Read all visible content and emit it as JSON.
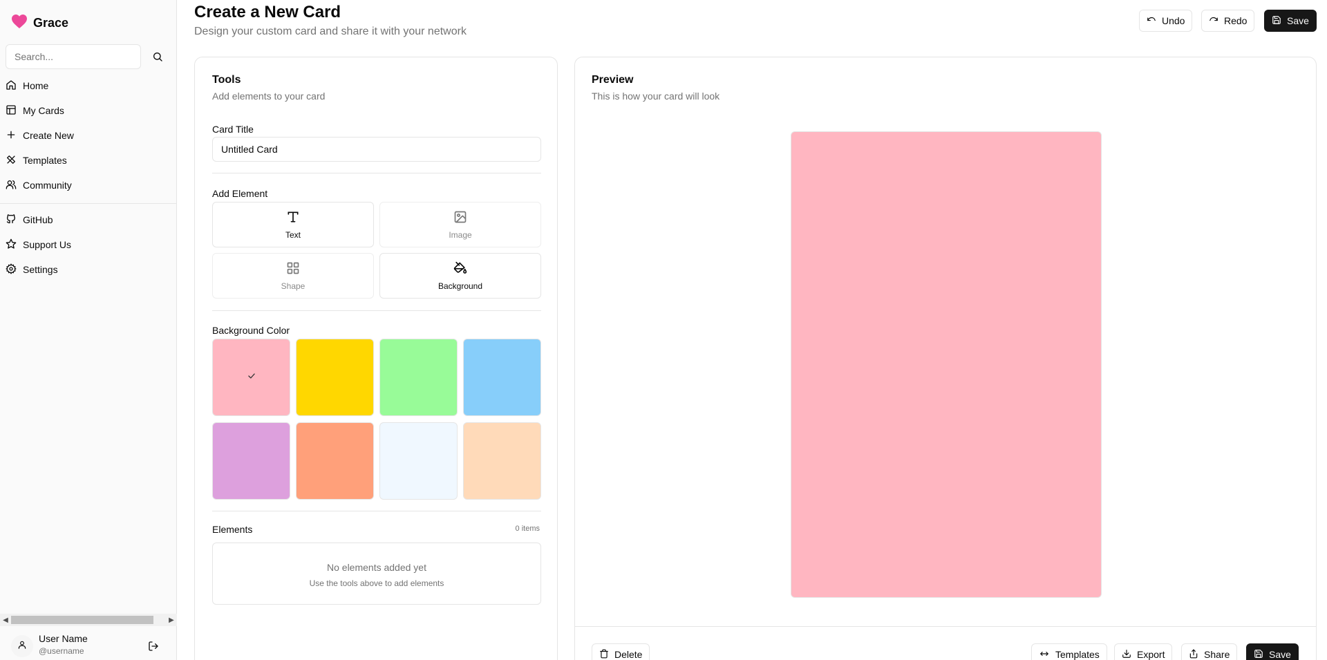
{
  "app": {
    "name": "Grace",
    "logo_icon": "heart-icon",
    "accent": "#ec4899"
  },
  "sidebar": {
    "search_placeholder": "Search...",
    "nav": [
      {
        "label": "Home",
        "icon": "home-icon"
      },
      {
        "label": "My Cards",
        "icon": "cards-icon"
      },
      {
        "label": "Create New",
        "icon": "plus-icon"
      },
      {
        "label": "Templates",
        "icon": "palette-icon"
      },
      {
        "label": "Community",
        "icon": "users-icon"
      }
    ],
    "secondary": [
      {
        "label": "GitHub",
        "icon": "github-icon"
      },
      {
        "label": "Support Us",
        "icon": "star-icon"
      },
      {
        "label": "Settings",
        "icon": "gear-icon"
      }
    ],
    "user": {
      "name": "User Name",
      "handle": "@username"
    }
  },
  "header": {
    "title": "Create a New Card",
    "subtitle": "Design your custom card and share it with your network",
    "undo_label": "Undo",
    "redo_label": "Redo",
    "save_label": "Save"
  },
  "tools": {
    "title": "Tools",
    "description": "Add elements to your card",
    "card_title_label": "Card Title",
    "card_title_value": "Untitled Card",
    "add_element_label": "Add Element",
    "elements": [
      {
        "label": "Text",
        "icon": "type-icon",
        "state": "enabled"
      },
      {
        "label": "Image",
        "icon": "image-icon",
        "state": "muted"
      },
      {
        "label": "Shape",
        "icon": "grid-icon",
        "state": "muted"
      },
      {
        "label": "Background",
        "icon": "paint-bucket-icon",
        "state": "enabled"
      }
    ],
    "background_color_label": "Background Color",
    "colors": [
      "#ffb6c1",
      "#ffd700",
      "#98fb98",
      "#87cefa",
      "#dda0dd",
      "#ffa07a",
      "#f0f8ff",
      "#ffdab9"
    ],
    "selected_color": "#ffb6c1",
    "elements_label": "Elements",
    "elements_count": "0 items",
    "empty_title": "No elements added yet",
    "empty_hint": "Use the tools above to add elements"
  },
  "preview": {
    "title": "Preview",
    "description": "This is how your card will look",
    "card_background": "#ffb6c1",
    "actions": {
      "delete": "Delete",
      "templates": "Templates",
      "export": "Export",
      "share": "Share",
      "save": "Save"
    }
  }
}
